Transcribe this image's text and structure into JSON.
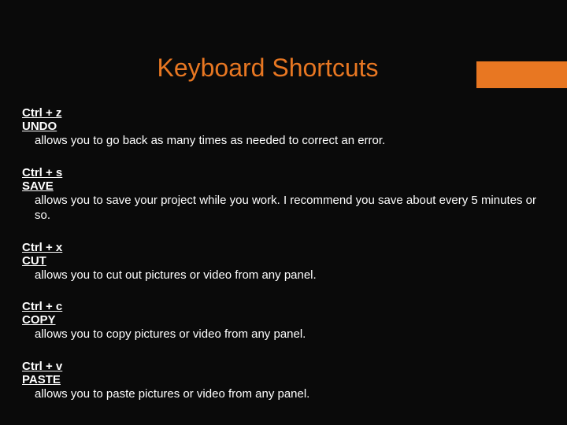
{
  "title": "Keyboard Shortcuts",
  "shortcuts": [
    {
      "keys": "Ctrl + z",
      "name": "UNDO",
      "desc": "allows you to go back as many times as needed to correct an error."
    },
    {
      "keys": "Ctrl + s",
      "name": "SAVE",
      "desc": "allows you to save your project while you work. I recommend you save about every 5 minutes or so."
    },
    {
      "keys": "Ctrl + x",
      "name": "CUT",
      "desc": "allows you to cut out pictures or video from any panel."
    },
    {
      "keys": "Ctrl + c",
      "name": "COPY",
      "desc": "allows you to copy pictures or video from any panel."
    },
    {
      "keys": "Ctrl + v",
      "name": "PASTE",
      "desc": "allows you to paste pictures or video from any panel."
    }
  ]
}
